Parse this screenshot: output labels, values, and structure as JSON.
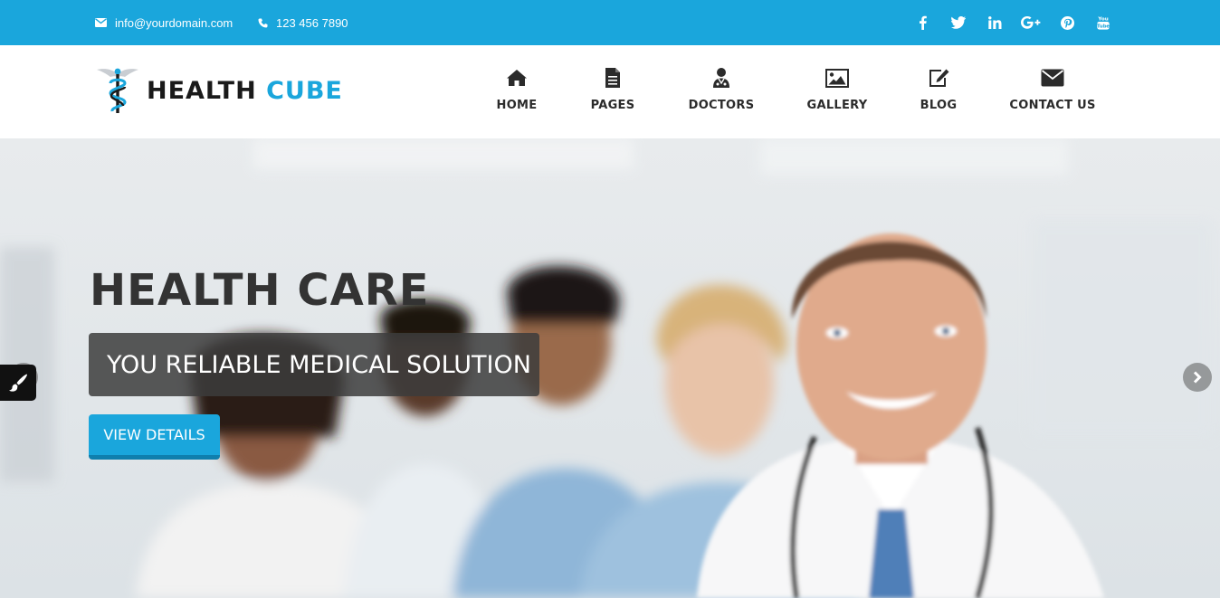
{
  "topbar": {
    "email": "info@yourdomain.com",
    "phone": "123 456 7890",
    "socials": [
      {
        "name": "facebook-icon",
        "glyph": "f"
      },
      {
        "name": "twitter-icon",
        "glyph": "t"
      },
      {
        "name": "linkedin-icon",
        "glyph": "in"
      },
      {
        "name": "google-plus-icon",
        "glyph": "G+"
      },
      {
        "name": "pinterest-icon",
        "glyph": "p"
      },
      {
        "name": "youtube-icon",
        "glyph": "You"
      }
    ]
  },
  "header": {
    "logo_part1": "HEALTH",
    "logo_part2": "CUBE",
    "nav": [
      {
        "label": "HOME",
        "icon": "home-icon"
      },
      {
        "label": "PAGES",
        "icon": "document-icon"
      },
      {
        "label": "DOCTORS",
        "icon": "doctor-icon"
      },
      {
        "label": "GALLERY",
        "icon": "image-icon"
      },
      {
        "label": "BLOG",
        "icon": "edit-icon"
      },
      {
        "label": "CONTACT US",
        "icon": "envelope-icon"
      }
    ]
  },
  "hero": {
    "title": "HEALTH CARE",
    "subtitle": "YOU RELIABLE MEDICAL SOLUTION",
    "button": "VIEW DETAILS"
  },
  "colors": {
    "brand": "#1aa6dc",
    "dark_text": "#333333"
  }
}
